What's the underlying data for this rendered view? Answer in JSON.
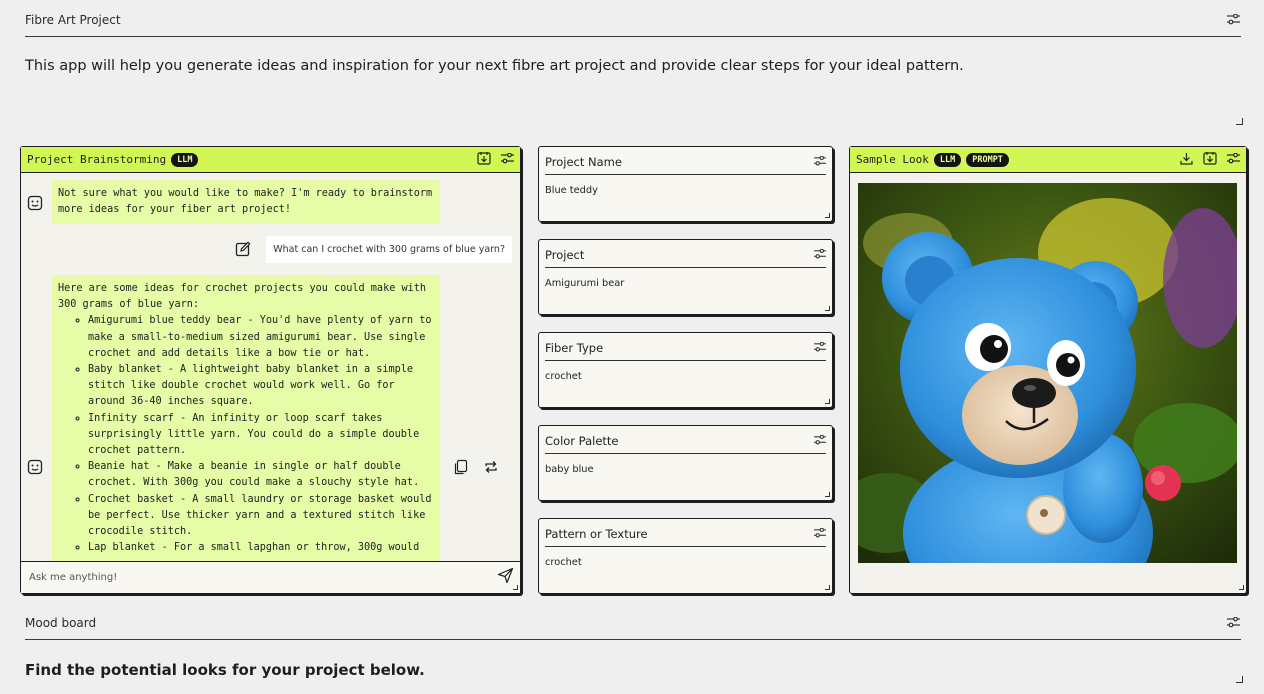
{
  "top_section": {
    "title": "Fibre Art Project",
    "description": "This app will help you generate ideas and inspiration for your next fibre art project and provide clear steps for your ideal pattern."
  },
  "chat": {
    "title": "Project Brainstorming",
    "badge": "LLM",
    "bot_greeting": "Not sure what you would like to make? I'm ready to brainstorm more ideas for your fiber art project!",
    "user_message": "What can I crochet with 300 grams of blue yarn?",
    "bot_reply_intro": "Here are some ideas for crochet projects you could make with 300 grams of blue yarn:",
    "bot_reply_items": [
      "Amigurumi blue teddy bear - You'd have plenty of yarn to make a small-to-medium sized amigurumi bear. Use single crochet and add details like a bow tie or hat.",
      "Baby blanket - A lightweight baby blanket in a simple stitch like double crochet would work well. Go for around 36-40 inches square.",
      "Infinity scarf - An infinity or loop scarf takes surprisingly little yarn. You could do a simple double crochet pattern.",
      "Beanie hat - Make a beanie in single or half double crochet. With 300g you could make a slouchy style hat.",
      "Crochet basket - A small laundry or storage basket would be perfect. Use thicker yarn and a textured stitch like crocodile stitch.",
      "Lap blanket - For a small lapghan or throw, 300g would"
    ],
    "input_placeholder": "Ask me anything!"
  },
  "fields": [
    {
      "label": "Project Name",
      "value": "Blue teddy"
    },
    {
      "label": "Project",
      "value": "Amigurumi bear"
    },
    {
      "label": "Fiber Type",
      "value": "crochet"
    },
    {
      "label": "Color Palette",
      "value": "baby blue"
    },
    {
      "label": "Pattern or Texture",
      "value": "crochet"
    }
  ],
  "sample_look": {
    "title": "Sample Look",
    "badge_llm": "LLM",
    "badge_prompt": "PROMPT",
    "image_subject": "blue crocheted amigurumi teddy bear"
  },
  "mood_board": {
    "title": "Mood board",
    "description": "Find the potential looks for your project below."
  },
  "colors": {
    "accent": "#d2f754",
    "bot_bubble": "#e6fca7",
    "background": "#efefef",
    "border": "#1d1d1d"
  },
  "icons": [
    "tune-icon",
    "bot-icon",
    "edit-icon",
    "copy-icon",
    "regenerate-icon",
    "send-icon",
    "save-icon",
    "download-icon"
  ]
}
